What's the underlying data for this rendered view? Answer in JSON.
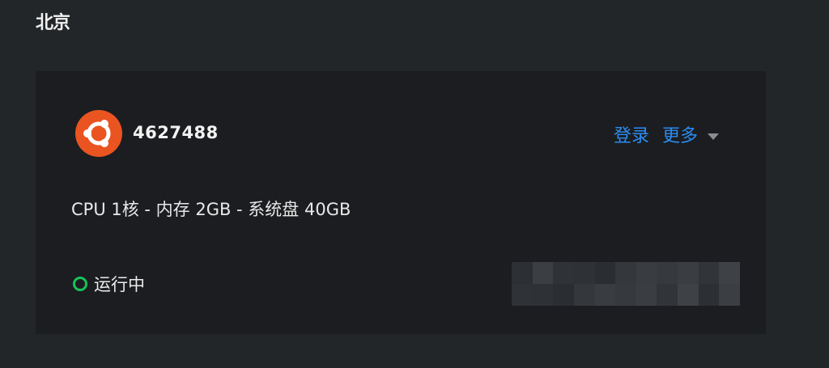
{
  "region": {
    "title": "北京"
  },
  "instance": {
    "id": "4627488",
    "os_icon": "ubuntu-logo-icon",
    "spec": "CPU 1核 - 内存 2GB - 系统盘 40GB",
    "status": "运行中",
    "status_icon": "status-ring-icon"
  },
  "actions": {
    "login_label": "登录",
    "more_label": "更多",
    "more_icon": "caret-down-icon"
  },
  "colors": {
    "background": "#232629",
    "card": "#1b1d20",
    "link": "#2b8cf2",
    "status_running": "#14c45a",
    "ubuntu_orange": "#e95420"
  }
}
